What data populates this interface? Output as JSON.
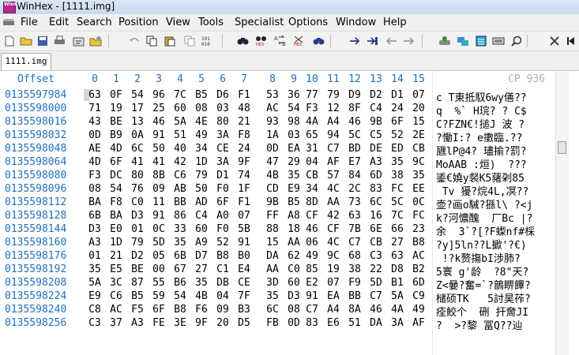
{
  "window": {
    "title": "WinHex - [1111.img]",
    "app_icon": "winhex-icon",
    "app_icon_text": "WinHex"
  },
  "menu": [
    "File",
    "Edit",
    "Search",
    "Position",
    "View",
    "Tools",
    "Specialist",
    "Options",
    "Window",
    "Help"
  ],
  "toolbar_icons": [
    "new-file-icon",
    "open-folder-icon",
    "save-icon",
    "print-icon",
    "properties-icon",
    "open-disk-icon",
    "undo-icon",
    "copy-icon",
    "paste-icon",
    "copy-block-icon",
    "write-hex-icon",
    "find-text-icon",
    "find-hex-icon",
    "replace-text-icon",
    "replace-hex-icon",
    "find-again-icon",
    "goto-offset-icon",
    "goto-sector-icon",
    "back-icon",
    "forward-icon",
    "disk-editor-icon",
    "ram-editor-icon",
    "calculator-icon",
    "hash-icon",
    "search-icon",
    "tools-icon",
    "media-icon"
  ],
  "tab": {
    "label": "1111.img"
  },
  "header": {
    "offset_label": "Offset",
    "columns": [
      "0",
      "1",
      "2",
      "3",
      "4",
      "5",
      "6",
      "7",
      "8",
      "9",
      "10",
      "11",
      "12",
      "13",
      "14",
      "15"
    ],
    "codepage": "CP 936"
  },
  "rows": [
    {
      "offset": "0135597984",
      "bytes": [
        "63",
        "0F",
        "54",
        "96",
        "7C",
        "B5",
        "D6",
        "F1",
        "53",
        "36",
        "77",
        "79",
        "D9",
        "D2",
        "D1",
        "07"
      ],
      "text": "c T東抵馭6wy僐??"
    },
    {
      "offset": "0135598000",
      "bytes": [
        "71",
        "19",
        "17",
        "25",
        "60",
        "08",
        "03",
        "48",
        "AC",
        "54",
        "F3",
        "12",
        "8F",
        "C4",
        "24",
        "20"
      ],
      "text": "q  %` H琓? ? C$"
    },
    {
      "offset": "0135598016",
      "bytes": [
        "43",
        "BE",
        "13",
        "46",
        "5A",
        "4E",
        "80",
        "21",
        "93",
        "98",
        "4A",
        "A4",
        "46",
        "9B",
        "6F",
        "15"
      ],
      "text": "C?FZN€!搥J 波 ?"
    },
    {
      "offset": "0135598032",
      "bytes": [
        "0D",
        "B9",
        "0A",
        "91",
        "51",
        "49",
        "3A",
        "F8",
        "1A",
        "03",
        "65",
        "94",
        "5C",
        "C5",
        "52",
        "2E"
      ],
      "text": "?慟I:? e擻臨.??"
    },
    {
      "offset": "0135598048",
      "bytes": [
        "AE",
        "4D",
        "6C",
        "50",
        "40",
        "34",
        "CE",
        "24",
        "0D",
        "EA",
        "31",
        "C7",
        "BD",
        "DE",
        "ED",
        "CB"
      ],
      "text": "甅lP@4? 璶揄?罰?"
    },
    {
      "offset": "0135598064",
      "bytes": [
        "4D",
        "6F",
        "41",
        "41",
        "42",
        "1D",
        "3A",
        "9F",
        "47",
        "29",
        "04",
        "AF",
        "E7",
        "A3",
        "35",
        "9C"
      ],
      "text": "MoAAB :烜)  ???"
    },
    {
      "offset": "0135598080",
      "bytes": [
        "F3",
        "DC",
        "80",
        "8B",
        "C6",
        "79",
        "D1",
        "74",
        "4B",
        "35",
        "CB",
        "57",
        "84",
        "6D",
        "38",
        "35"
      ],
      "text": "鋈€嬈y裻K5蕏刴85"
    },
    {
      "offset": "0135598096",
      "bytes": [
        "08",
        "54",
        "76",
        "09",
        "AB",
        "50",
        "F0",
        "1F",
        "CD",
        "E9",
        "34",
        "4C",
        "2C",
        "83",
        "FC",
        "EE"
      ],
      "text": " Tv 獶?烷4L,凕??"
    },
    {
      "offset": "0135598112",
      "bytes": [
        "BA",
        "F8",
        "C0",
        "11",
        "BB",
        "AD",
        "6F",
        "F1",
        "9B",
        "B5",
        "8D",
        "AA",
        "73",
        "6C",
        "5C",
        "0C"
      ],
      "text": "壶?画o駴?猻l\\ ?<j"
    },
    {
      "offset": "0135598128",
      "bytes": [
        "6B",
        "BA",
        "D3",
        "91",
        "86",
        "C4",
        "A0",
        "07",
        "FF",
        "A8",
        "CF",
        "42",
        "63",
        "16",
        "7C",
        "FC"
      ],
      "text": "k?河憹醜  厂Bc |?"
    },
    {
      "offset": "0135598144",
      "bytes": [
        "D3",
        "E0",
        "01",
        "0C",
        "33",
        "60",
        "F0",
        "5B",
        "88",
        "18",
        "46",
        "CF",
        "7B",
        "6E",
        "66",
        "23"
      ],
      "text": "余  3`?[?F蟍nf#棌"
    },
    {
      "offset": "0135598160",
      "bytes": [
        "A3",
        "1D",
        "79",
        "5D",
        "35",
        "A9",
        "52",
        "91",
        "15",
        "AA",
        "06",
        "4C",
        "C7",
        "CB",
        "27",
        "B8"
      ],
      "text": "?y]5ln??L擨'?€)"
    },
    {
      "offset": "0135598176",
      "bytes": [
        "01",
        "21",
        "D2",
        "05",
        "6B",
        "D7",
        "B8",
        "B0",
        "DA",
        "62",
        "49",
        "9C",
        "68",
        "C3",
        "63",
        "AC"
      ],
      "text": " !?k赘摥bI涉肺?"
    },
    {
      "offset": "0135598192",
      "bytes": [
        "35",
        "E5",
        "BE",
        "00",
        "67",
        "27",
        "C1",
        "E4",
        "AA",
        "C0",
        "85",
        "19",
        "38",
        "22",
        "D8",
        "B2"
      ],
      "text": "5寰 g'龄  ?8\"天?"
    },
    {
      "offset": "0135598208",
      "bytes": [
        "5A",
        "3C",
        "87",
        "55",
        "B6",
        "35",
        "DB",
        "CE",
        "3D",
        "60",
        "E2",
        "07",
        "F9",
        "5D",
        "B1",
        "6D"
      ],
      "text": "Z<嘦?奮=`?鶕睤饆?"
    },
    {
      "offset": "0135598224",
      "bytes": [
        "E9",
        "C6",
        "B5",
        "59",
        "54",
        "4B",
        "04",
        "7F",
        "35",
        "D3",
        "91",
        "EA",
        "BB",
        "C7",
        "5A",
        "C9"
      ],
      "text": "槠硕TK   5討昊莋?"
    },
    {
      "offset": "0135598240",
      "bytes": [
        "C8",
        "AC",
        "F5",
        "6F",
        "B8",
        "F6",
        "09",
        "B3",
        "6C",
        "08",
        "C7",
        "A4",
        "8A",
        "46",
        "4A",
        "49"
      ],
      "text": "痊鮫个  硎 扞奝JI"
    },
    {
      "offset": "0135598256",
      "bytes": [
        "C3",
        "37",
        "A3",
        "FE",
        "3E",
        "9F",
        "20",
        "D5",
        "FB",
        "0D",
        "83",
        "E6",
        "51",
        "DA",
        "3A",
        "AF"
      ],
      "text": "?  >?黎 冨Q??辿"
    }
  ]
}
